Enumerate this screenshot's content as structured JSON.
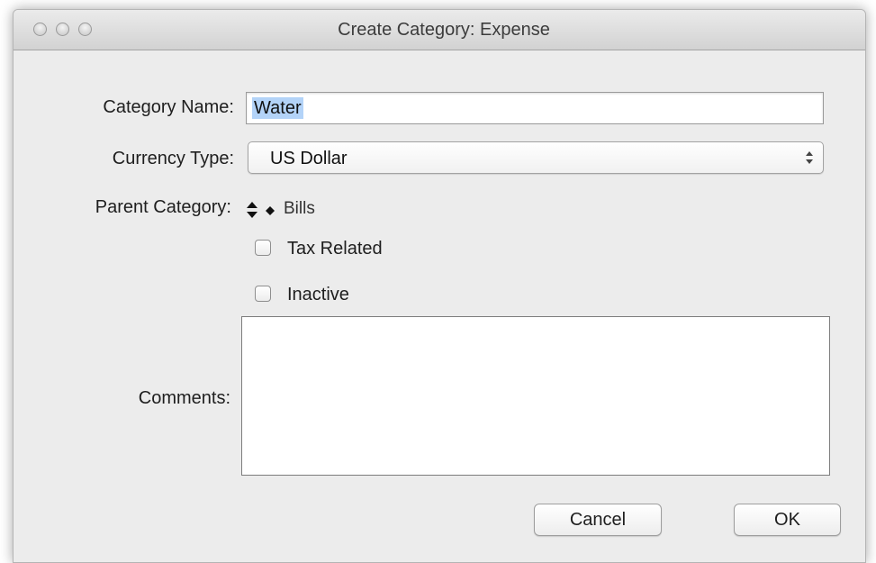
{
  "window": {
    "title": "Create Category: Expense"
  },
  "form": {
    "category_name_label": "Category Name:",
    "category_name_value": "Water",
    "currency_type_label": "Currency Type:",
    "currency_type_value": "US Dollar",
    "parent_category_label": "Parent Category:",
    "parent_category_value": "Bills",
    "tax_related_label": "Tax Related",
    "tax_related_checked": false,
    "inactive_label": "Inactive",
    "inactive_checked": false,
    "comments_label": "Comments:",
    "comments_value": ""
  },
  "buttons": {
    "cancel_label": "Cancel",
    "ok_label": "OK"
  },
  "icons": {
    "close": "traffic-light-close-icon",
    "minimize": "traffic-light-minimize-icon",
    "zoom": "traffic-light-zoom-icon",
    "select_arrows": "up-down-arrows-icon",
    "parent_arrows": "up-down-arrows-icon",
    "parent_bullet": "diamond-bullet-icon"
  },
  "colors": {
    "selection_highlight": "#b3d3f8",
    "window_background": "#ececec"
  }
}
